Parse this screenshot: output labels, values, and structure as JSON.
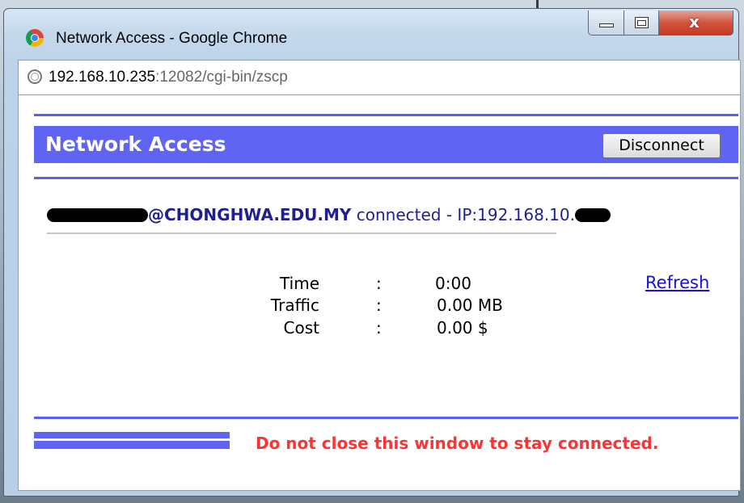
{
  "window": {
    "title": "Network Access - Google Chrome",
    "controls": {
      "minimize": "minimize",
      "maximize": "maximize",
      "close": "x"
    }
  },
  "address_bar": {
    "host": "192.168.10.235",
    "rest": ":12082/cgi-bin/zscp"
  },
  "page": {
    "header_title": "Network Access",
    "disconnect_label": "Disconnect",
    "user_domain": "@CHONGHWA.EDU.MY",
    "status_text": "connected - IP:192.168.10.",
    "stats": [
      {
        "label": "Time",
        "colon": ":",
        "value": "0:00"
      },
      {
        "label": "Traffic",
        "colon": ":",
        "value": "0.00 MB"
      },
      {
        "label": "Cost",
        "colon": ":",
        "value": "0.00 $"
      }
    ],
    "refresh_label": "Refresh",
    "warning": "Do not close this window to stay connected."
  },
  "colors": {
    "accent": "#6064f2",
    "warning": "#ff3333",
    "link": "#1a10d8"
  }
}
